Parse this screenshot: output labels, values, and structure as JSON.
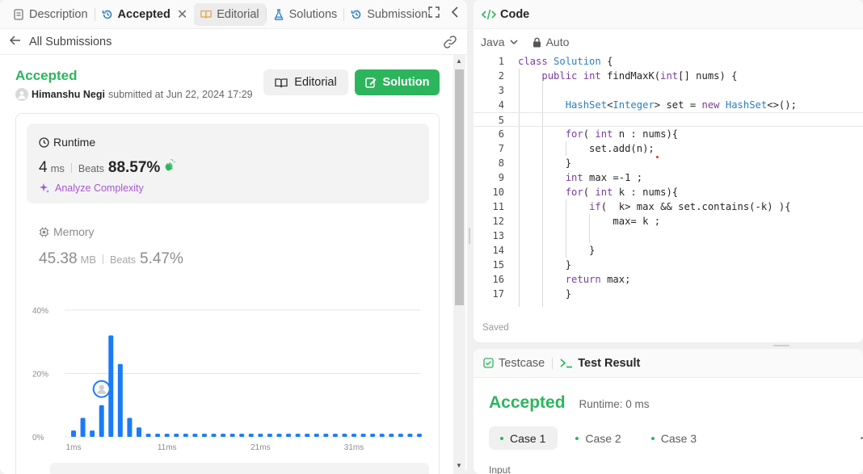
{
  "left_tabs": [
    {
      "label": "Description"
    },
    {
      "label": "Accepted"
    },
    {
      "label": "Editorial"
    },
    {
      "label": "Solutions"
    },
    {
      "label": "Submission:"
    }
  ],
  "subheader": {
    "back_label": "All Submissions"
  },
  "submission": {
    "status": "Accepted",
    "user": "Himanshu Negi",
    "submitted_text": "submitted at Jun 22, 2024 17:29",
    "editorial_btn": "Editorial",
    "solution_btn": "Solution"
  },
  "runtime": {
    "label": "Runtime",
    "value": "4",
    "unit": "ms",
    "beats_label": "Beats",
    "beats": "88.57%",
    "analyze": "Analyze Complexity"
  },
  "memory": {
    "label": "Memory",
    "value": "45.38",
    "unit": "MB",
    "beats_label": "Beats",
    "beats": "5.47%"
  },
  "chart_data": {
    "type": "bar",
    "y_ticks": [
      "40%",
      "20%",
      "0%"
    ],
    "x_ticks": [
      "1ms",
      "11ms",
      "21ms",
      "31ms"
    ],
    "ylim": [
      0,
      40
    ],
    "values": [
      2,
      6,
      2,
      10,
      32,
      23,
      6,
      3,
      1,
      1,
      1,
      1,
      1,
      1,
      1,
      1,
      1,
      1,
      1,
      1,
      1,
      1,
      1,
      1,
      1,
      1,
      1,
      1,
      1,
      1,
      1,
      1,
      1,
      1,
      1,
      1,
      1,
      1
    ],
    "highlight_index": 3,
    "bar_color": "#1a7cf5"
  },
  "code_panel": {
    "title": "Code",
    "language": "Java",
    "mode": "Auto",
    "saved": "Saved",
    "lines": [
      "class Solution {",
      "    public int findMaxK(int[] nums) {",
      "",
      "        HashSet<Integer> set = new HashSet<>();",
      "",
      "        for( int n : nums){",
      "            set.add(n);",
      "        }",
      "        int max =-1 ;",
      "        for( int k : nums){",
      "            if(  k> max && set.contains(-k) ){",
      "                max= k ;",
      "",
      "            }",
      "        }",
      "        return max;",
      "        }"
    ],
    "line_numbers": [
      "1",
      "2",
      "3",
      "4",
      "5",
      "6",
      "7",
      "8",
      "9",
      "10",
      "11",
      "12",
      "13",
      "14",
      "15",
      "16",
      "17"
    ]
  },
  "test_panel": {
    "tab_testcase": "Testcase",
    "tab_result": "Test Result",
    "result": "Accepted",
    "runtime_text": "Runtime: 0 ms",
    "cases": [
      "Case 1",
      "Case 2",
      "Case 3"
    ],
    "input_label": "Input"
  }
}
